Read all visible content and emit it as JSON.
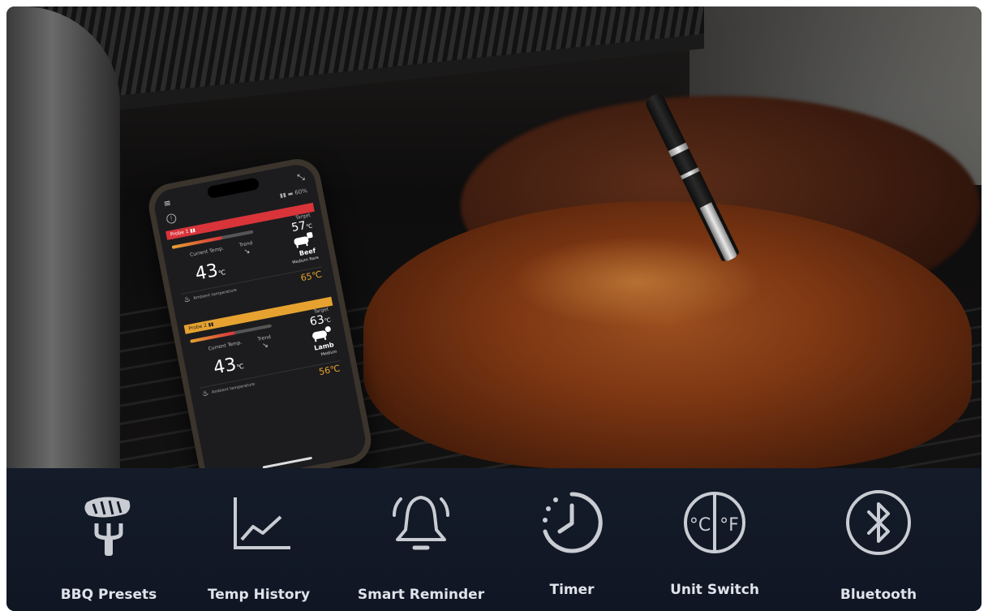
{
  "phone": {
    "menu_icon": "≡",
    "collapse_icon": "⤡",
    "signal": "▮▮ ▬ 60%",
    "probes": [
      {
        "header": "Probe 1 ▮▮",
        "target_label": "Target",
        "target_value": "57",
        "target_unit": "℃",
        "current_label": "Current Temp.",
        "trend_label": "Trend",
        "trend_symbol": "↘",
        "current_value": "43",
        "current_unit": "℃",
        "meat_name": "Beef",
        "doneness": "Medium Rare",
        "ambient_label": "Ambient temperature",
        "ambient_value": "65℃",
        "progress": 0.62
      },
      {
        "header": "Probe 2 ▮▮",
        "target_label": "Target",
        "target_value": "63",
        "target_unit": "℃",
        "current_label": "Current Temp.",
        "trend_label": "Trend",
        "trend_symbol": "↘",
        "current_value": "43",
        "current_unit": "℃",
        "meat_name": "Lamb",
        "doneness": "Medium",
        "ambient_label": "Ambient temperature",
        "ambient_value": "56℃",
        "progress": 0.55
      }
    ]
  },
  "features": [
    {
      "label": "BBQ Presets",
      "icon": "grill-steak-icon"
    },
    {
      "label": "Temp History",
      "icon": "line-chart-icon"
    },
    {
      "label": "Smart Reminder",
      "icon": "bell-icon"
    },
    {
      "label": "Timer",
      "icon": "clock-timer-icon"
    },
    {
      "label": "Unit Switch",
      "icon": "celsius-fahrenheit-icon"
    },
    {
      "label": "Bluetooth",
      "icon": "bluetooth-icon"
    }
  ],
  "colors": {
    "probe1": "#d8343a",
    "probe2": "#e6a230",
    "feature_bar": "#131a27",
    "icon_stroke": "#c9ccd2"
  }
}
